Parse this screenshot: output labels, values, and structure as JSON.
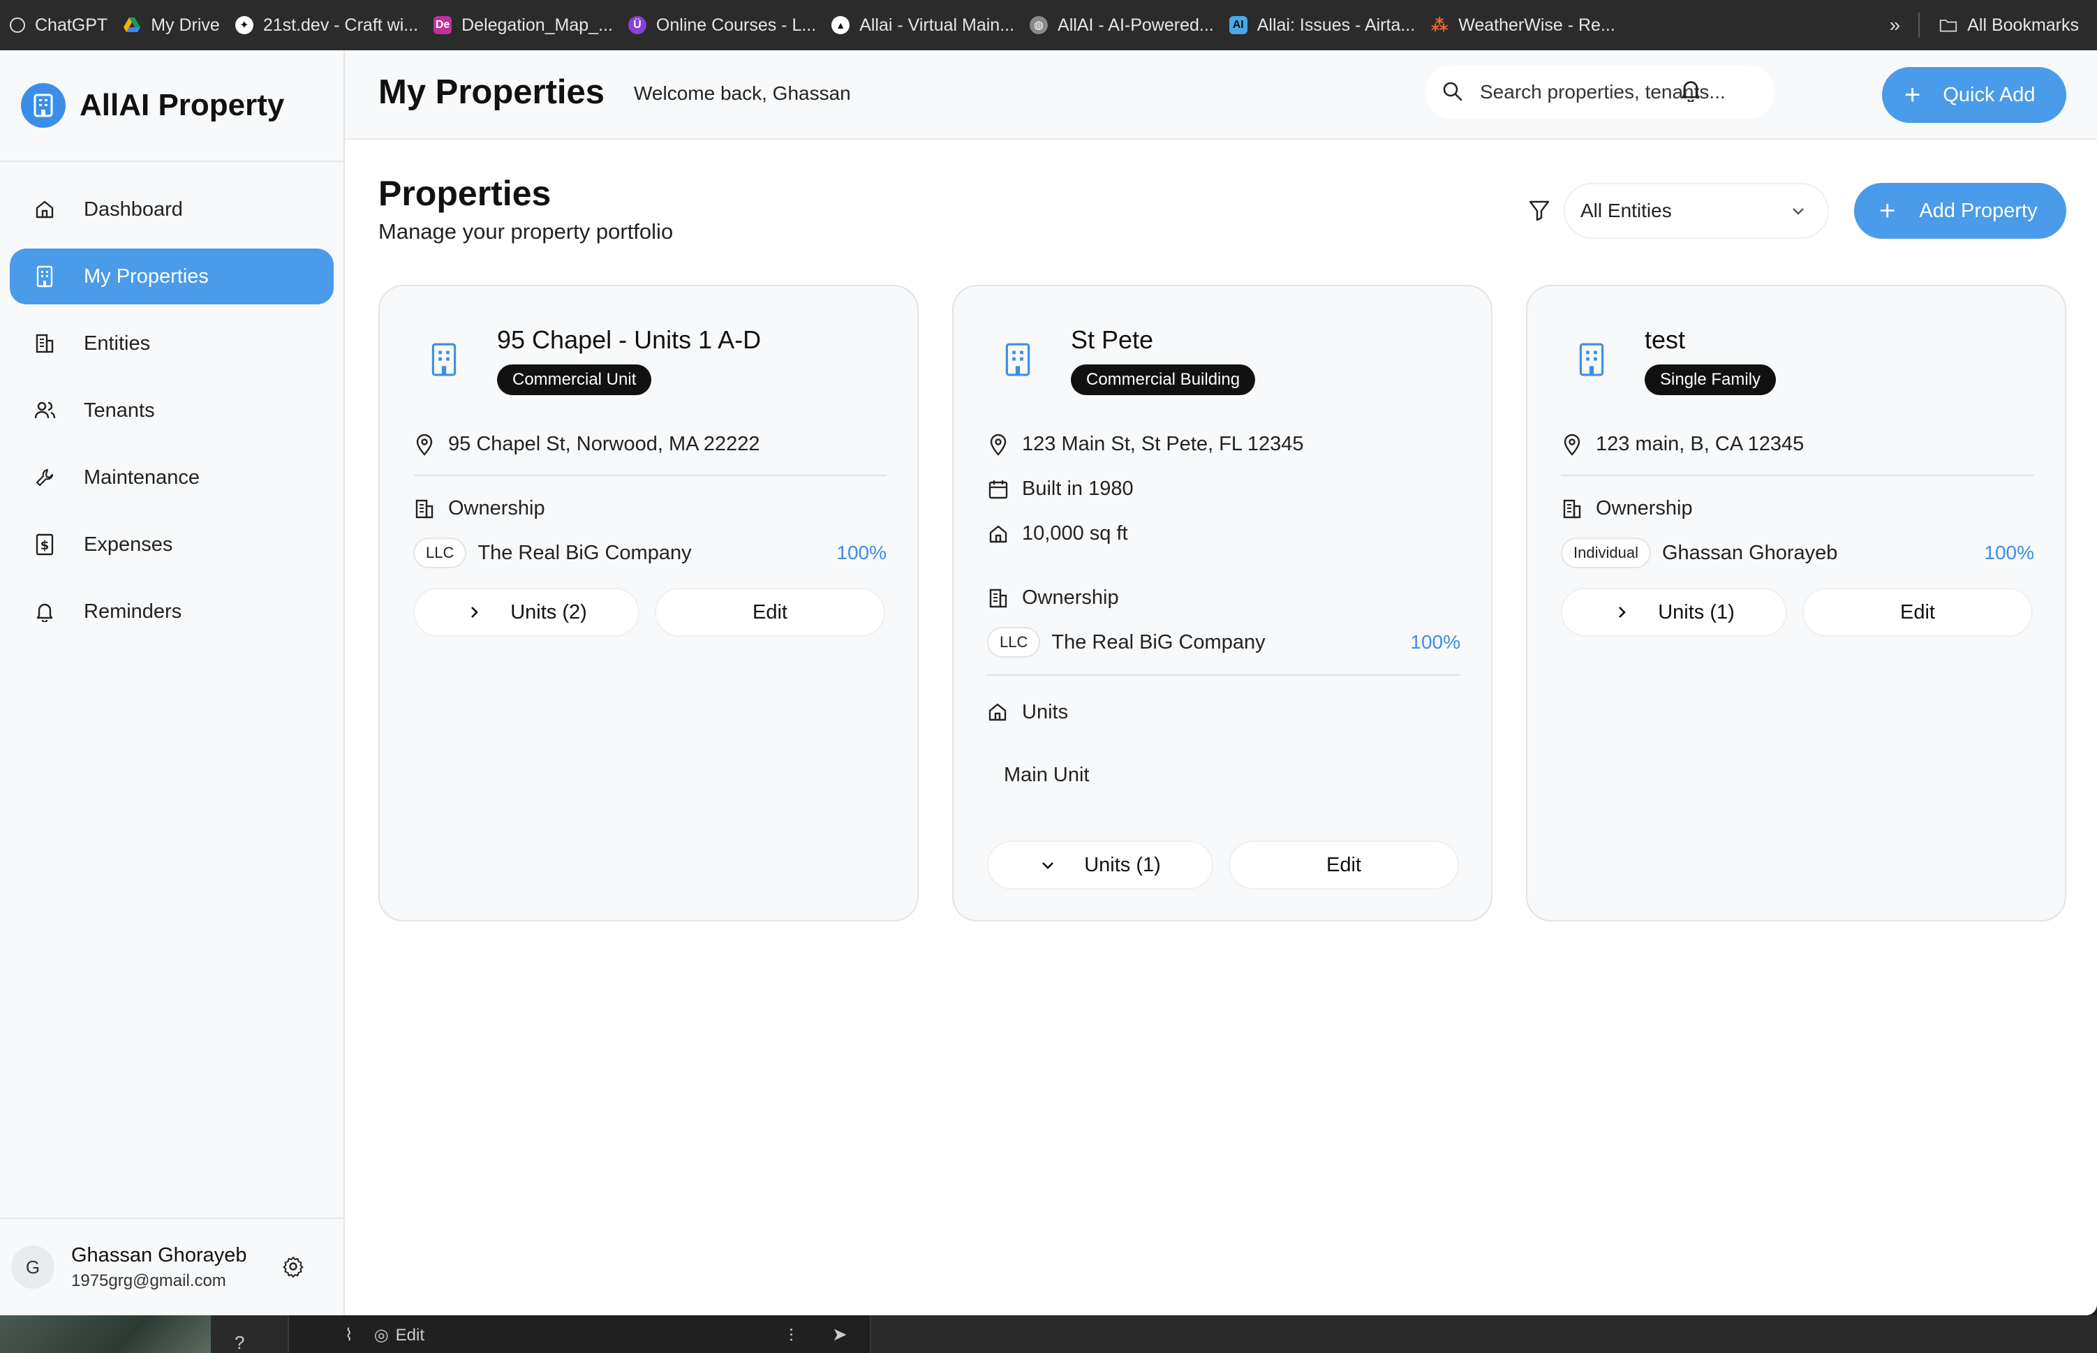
{
  "bookmarks": [
    {
      "label": "ChatGPT",
      "icon": "chatgpt-icon",
      "color": "#2b2b2b"
    },
    {
      "label": "My Drive",
      "icon": "google-drive-icon",
      "color": "#f4b400"
    },
    {
      "label": "21st.dev - Craft wi...",
      "icon": "21st-icon",
      "color": "#ffffff"
    },
    {
      "label": "Delegation_Map_...",
      "icon": "adobe-de-icon",
      "color": "#c0309a"
    },
    {
      "label": "Online Courses - L...",
      "icon": "udemy-icon",
      "color": "#8b3fd8"
    },
    {
      "label": "Allai - Virtual Main...",
      "icon": "triangle-icon",
      "color": "#ffffff"
    },
    {
      "label": "AllAI - AI-Powered...",
      "icon": "globe-icon",
      "color": "#8a8a8a"
    },
    {
      "label": "Allai: Issues - Airta...",
      "icon": "ai-icon",
      "color": "#4aa8e8"
    },
    {
      "label": "WeatherWise - Re...",
      "icon": "weatherwise-icon",
      "color": "#f06a28"
    }
  ],
  "bookmarks_all": "All Bookmarks",
  "sidebar": {
    "brand": "AllAI Property",
    "items": [
      {
        "label": "Dashboard",
        "icon": "home-icon",
        "active": false
      },
      {
        "label": "My Properties",
        "icon": "building-icon",
        "active": true
      },
      {
        "label": "Entities",
        "icon": "entities-icon",
        "active": false
      },
      {
        "label": "Tenants",
        "icon": "users-icon",
        "active": false
      },
      {
        "label": "Maintenance",
        "icon": "wrench-icon",
        "active": false
      },
      {
        "label": "Expenses",
        "icon": "dollar-icon",
        "active": false
      },
      {
        "label": "Reminders",
        "icon": "bell-icon",
        "active": false
      }
    ],
    "user": {
      "initial": "G",
      "name": "Ghassan Ghorayeb",
      "email": "1975grg@gmail.com"
    }
  },
  "header": {
    "title": "My Properties",
    "welcome": "Welcome back, Ghassan",
    "search_placeholder": "Search properties, tenants...",
    "quick_add": "Quick Add"
  },
  "main": {
    "title": "Properties",
    "subtitle": "Manage your property portfolio",
    "filter_value": "All Entities",
    "add_property": "Add Property"
  },
  "cards": [
    {
      "name": "95 Chapel - Units 1 A-D",
      "type": "Commercial Unit",
      "address": "95 Chapel St, Norwood, MA 22222",
      "ownership_label": "Ownership",
      "owner_type": "LLC",
      "owner_name": "The Real BiG Company",
      "owner_pct": "100%",
      "units_button": "Units (2)",
      "edit_button": "Edit"
    },
    {
      "name": "St Pete",
      "type": "Commercial Building",
      "address": "123 Main St, St Pete, FL 12345",
      "built": "Built in 1980",
      "size": "10,000 sq ft",
      "ownership_label": "Ownership",
      "owner_type": "LLC",
      "owner_name": "The Real BiG Company",
      "owner_pct": "100%",
      "units_label": "Units",
      "unit_item": "Main Unit",
      "units_button": "Units (1)",
      "edit_button": "Edit"
    },
    {
      "name": "test",
      "type": "Single Family",
      "address": "123 main, B, CA 12345",
      "ownership_label": "Ownership",
      "owner_type": "Individual",
      "owner_name": "Ghassan Ghorayeb",
      "owner_pct": "100%",
      "units_button": "Units (1)",
      "edit_button": "Edit"
    }
  ],
  "taskbar": {
    "question": "?",
    "edit": "Edit"
  },
  "colors": {
    "accent": "#4a9be9",
    "badge": "#111111",
    "percent": "#3b8ee8"
  }
}
